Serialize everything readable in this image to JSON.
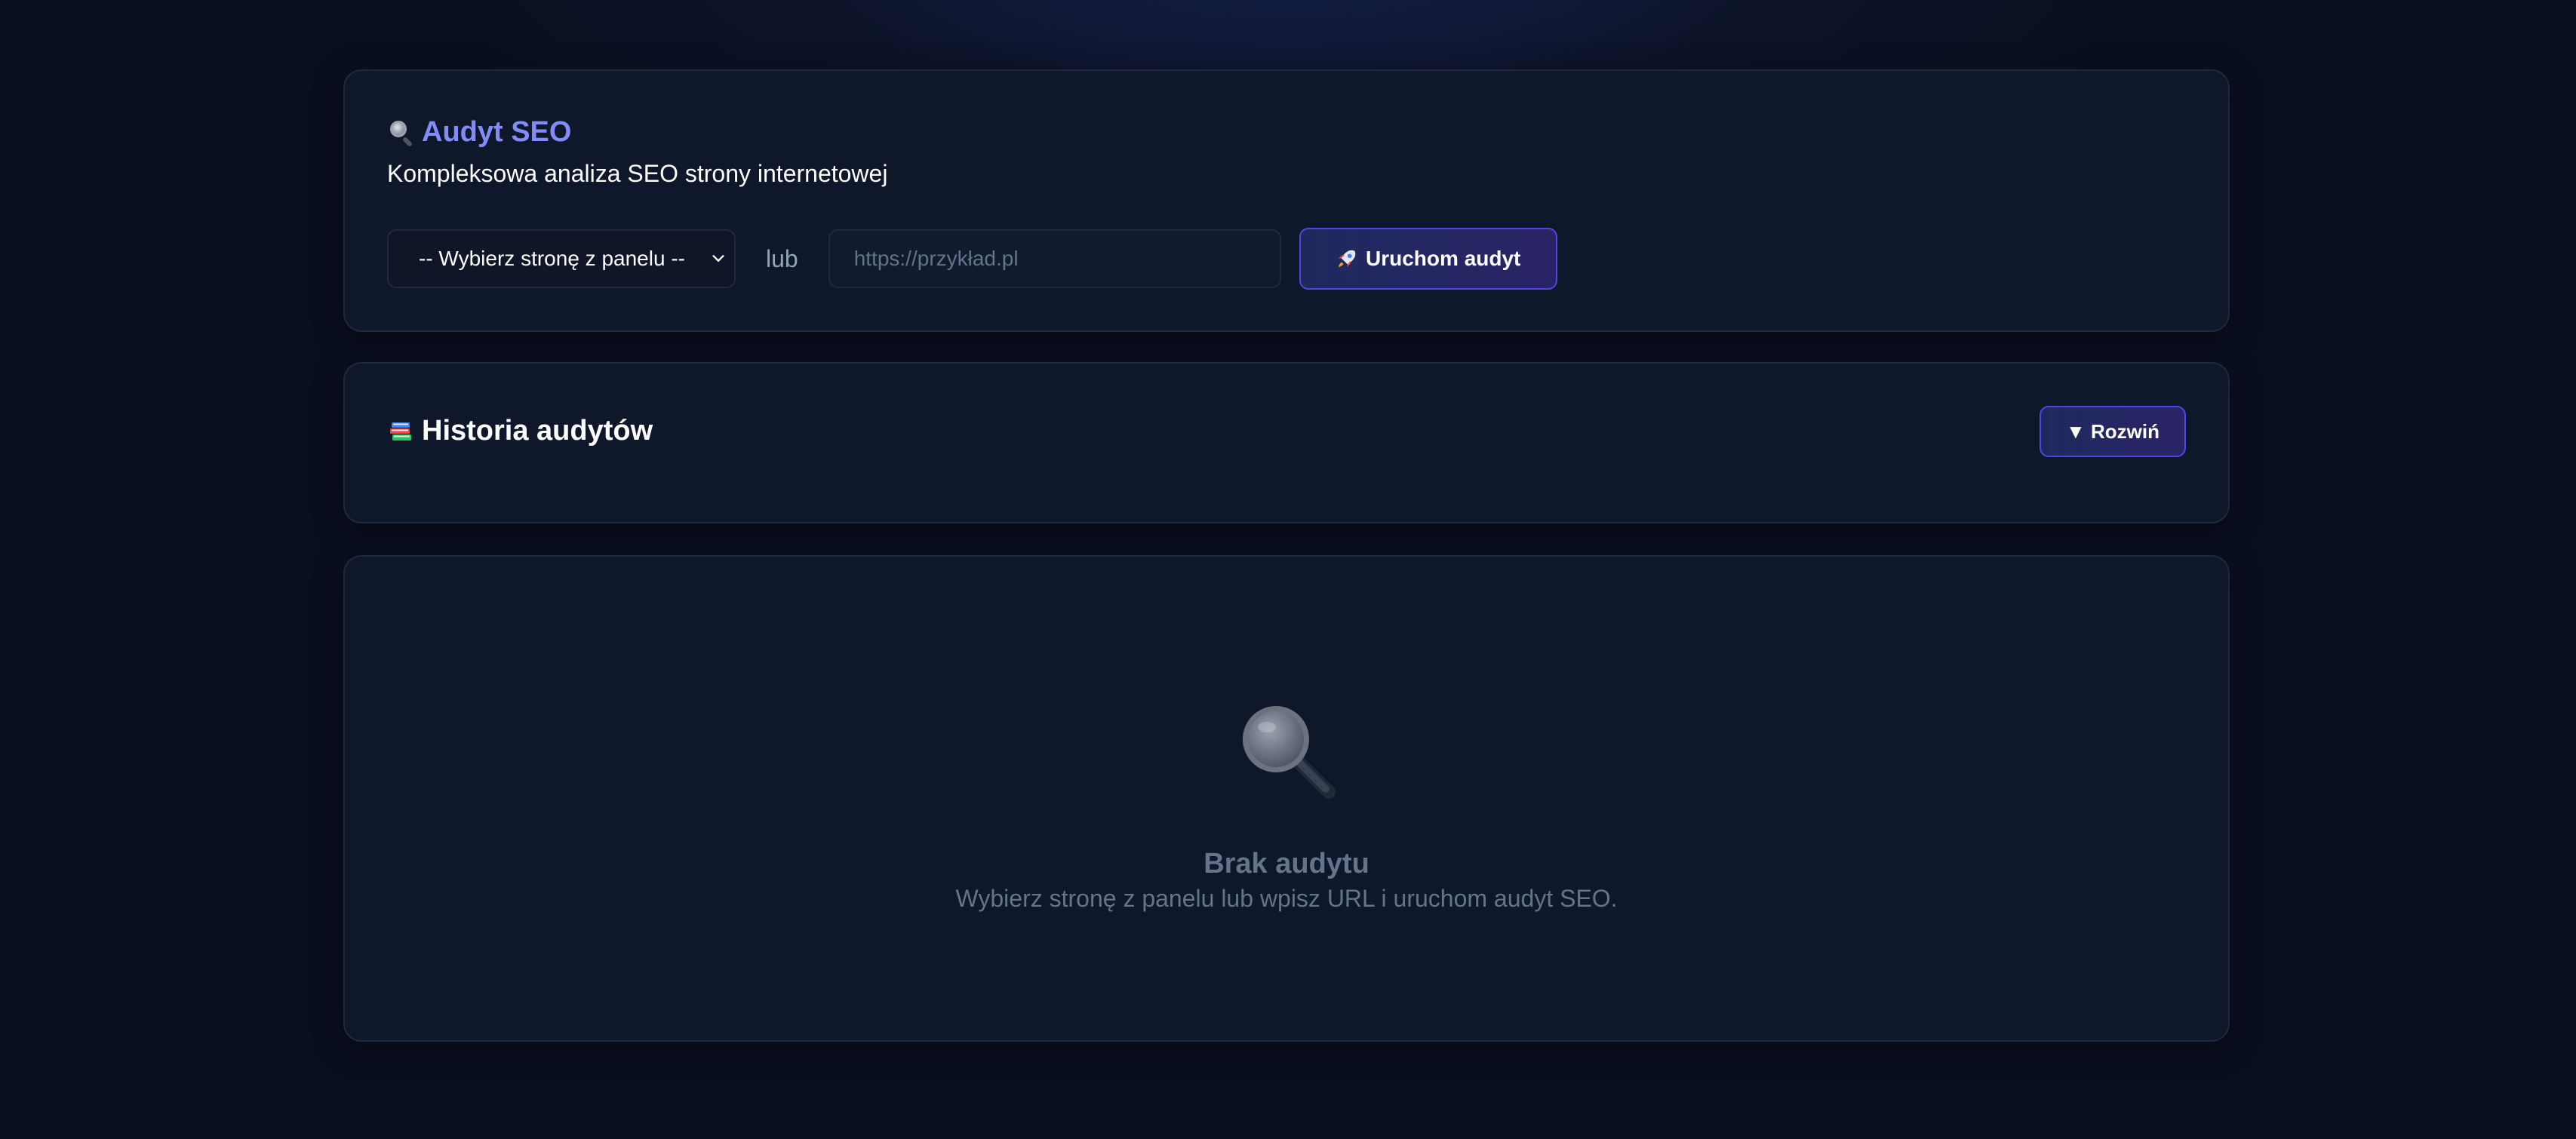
{
  "audit": {
    "title": "Audyt SEO",
    "subtitle": "Kompleksowa analiza SEO strony internetowej",
    "select_value": "-- Wybierz stronę z panelu --",
    "or_label": "lub",
    "url_placeholder": "https://przykład.pl",
    "url_value": "",
    "run_button": "Uruchom audyt"
  },
  "history": {
    "title": "Historia audytów",
    "expand_button": "▼ Rozwiń"
  },
  "empty_state": {
    "title": "Brak audytu",
    "description": "Wybierz stronę z panelu lub wpisz URL i uruchom audyt SEO."
  },
  "icons": {
    "audit": "magnifying-glass-icon",
    "run": "rocket-icon",
    "history": "books-icon",
    "empty": "magnifying-glass-icon"
  },
  "colors": {
    "accent": "#818cf8",
    "button_border": "#4f46e5",
    "card_bg": "#0f172a",
    "muted_text": "#64748b"
  }
}
